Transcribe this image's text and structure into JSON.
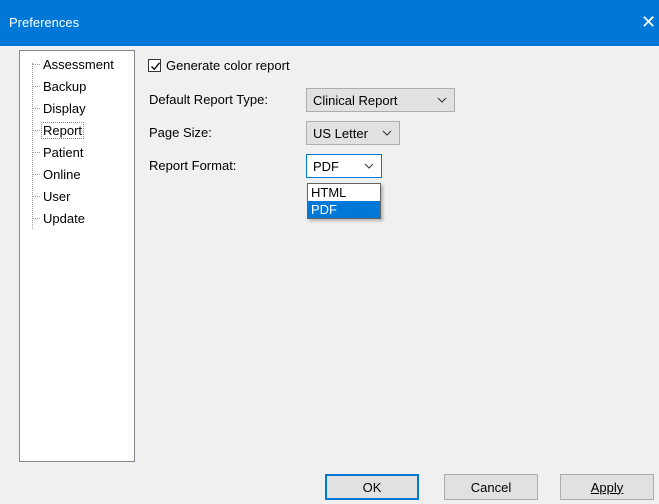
{
  "window": {
    "title": "Preferences",
    "close_glyph": "✕"
  },
  "tree": {
    "items": [
      {
        "label": "Assessment"
      },
      {
        "label": "Backup"
      },
      {
        "label": "Display"
      },
      {
        "label": "Report",
        "selected": true
      },
      {
        "label": "Patient"
      },
      {
        "label": "Online"
      },
      {
        "label": "User"
      },
      {
        "label": "Update"
      }
    ]
  },
  "report": {
    "color_report_label": "Generate color report",
    "color_report_checked": true,
    "default_type_label": "Default Report Type:",
    "default_type_value": "Clinical Report",
    "page_size_label": "Page Size:",
    "page_size_value": "US Letter",
    "format_label": "Report Format:",
    "format_value": "PDF",
    "format_options": [
      "HTML",
      "PDF"
    ],
    "format_selected_option": "PDF"
  },
  "buttons": {
    "ok": "OK",
    "cancel": "Cancel",
    "apply": "Apply"
  },
  "colors": {
    "titlebar": "#0078d7",
    "selection": "#0078d7"
  }
}
